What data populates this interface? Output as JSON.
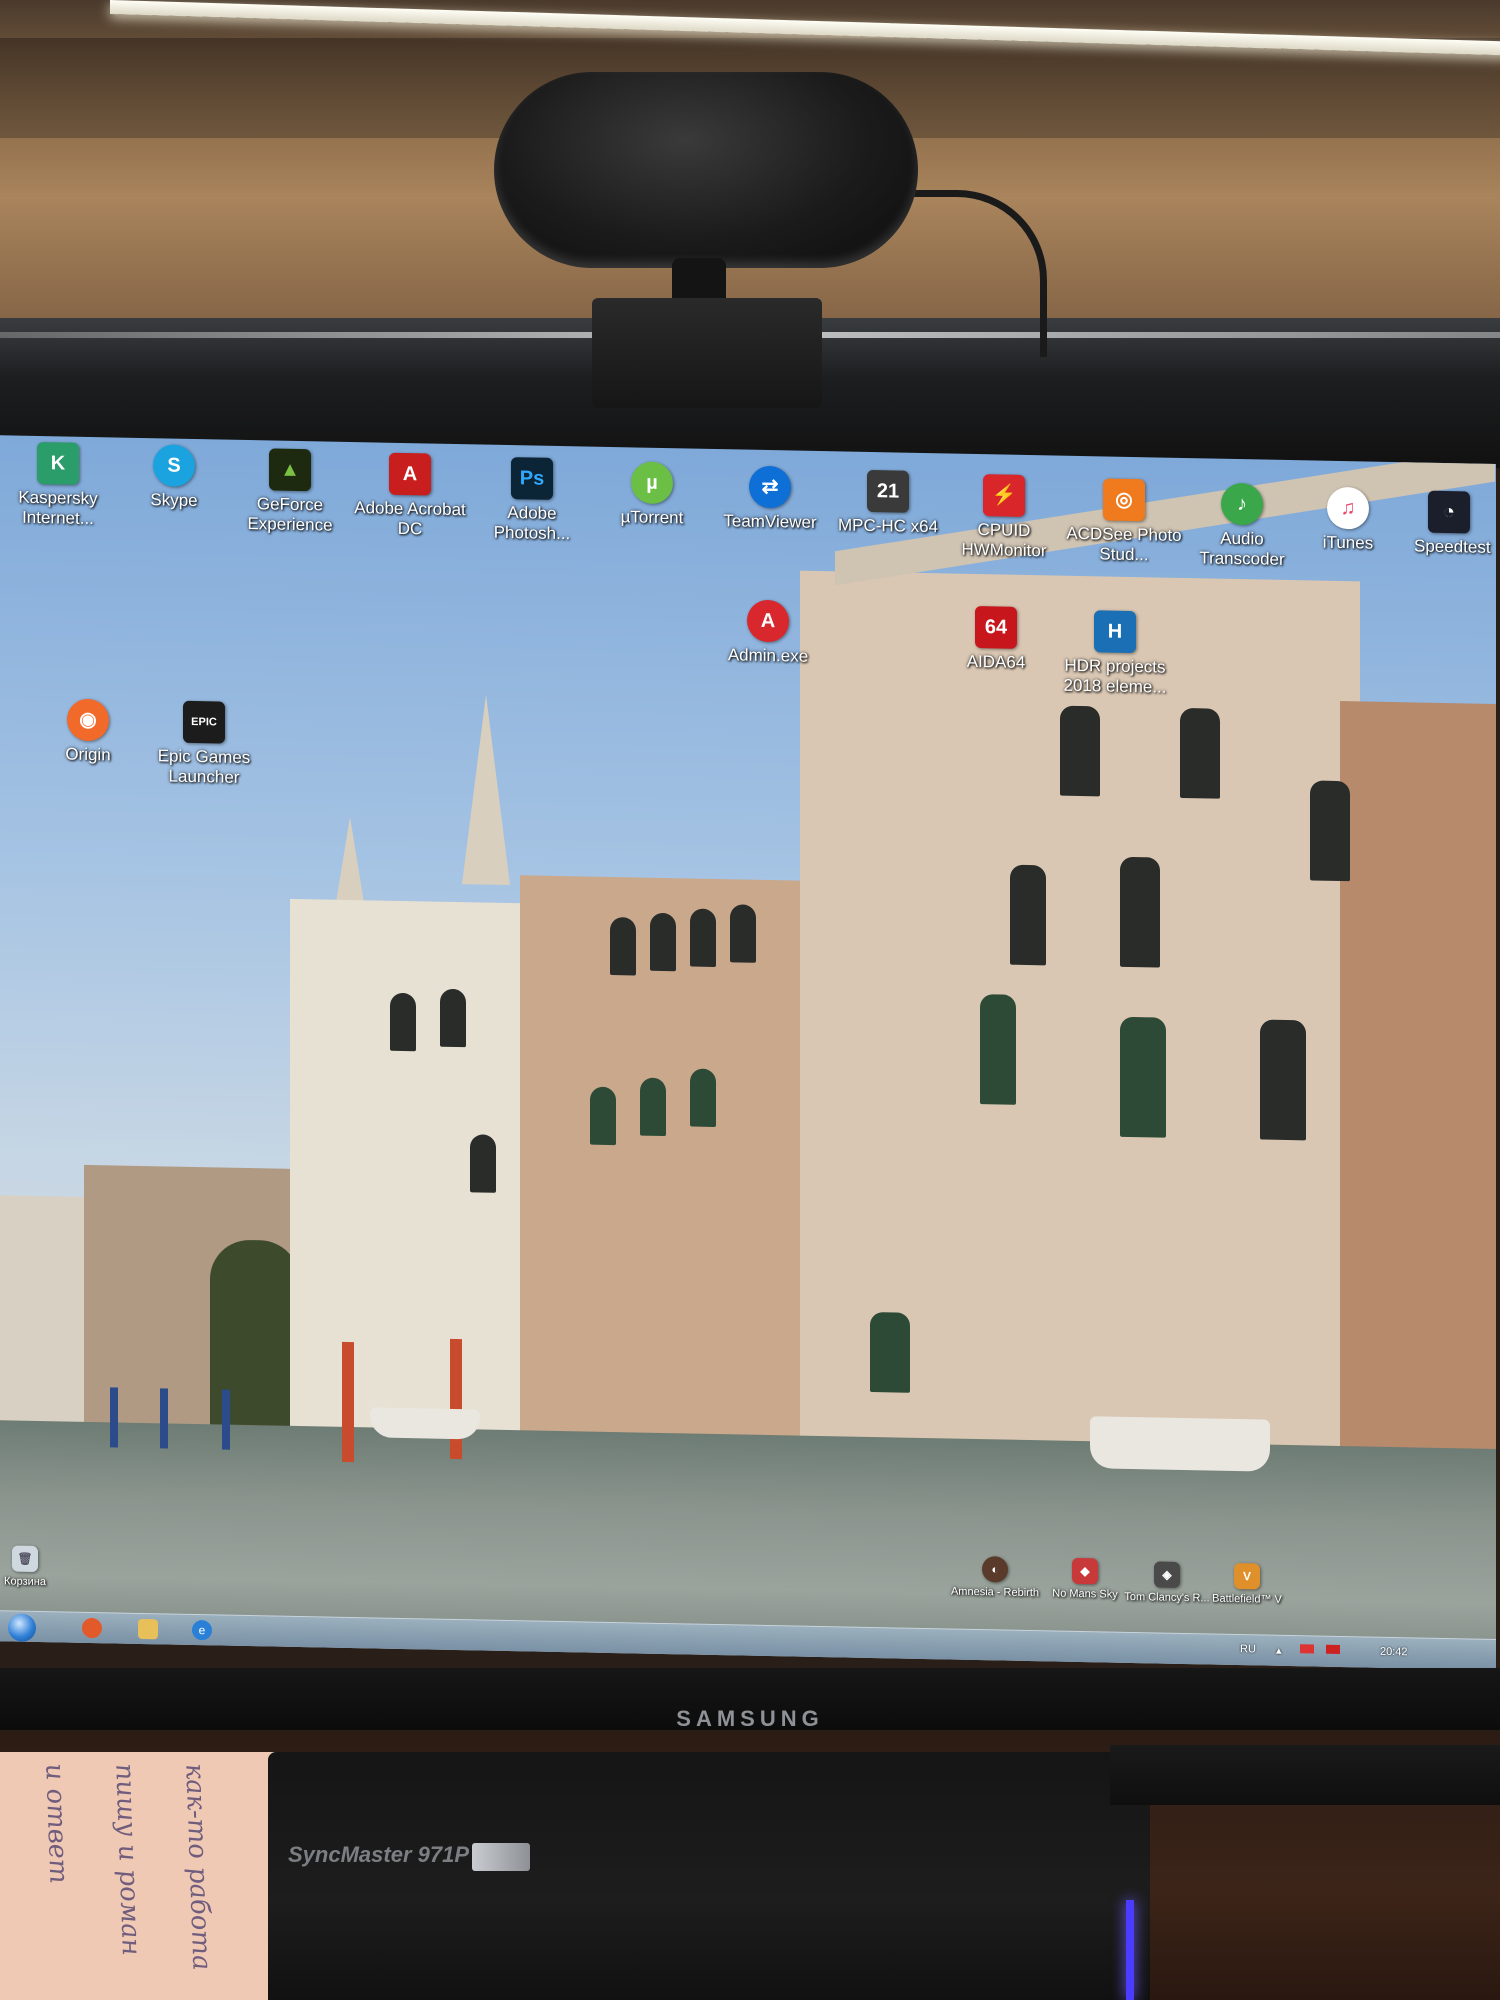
{
  "monitor": {
    "brand": "SAMSUNG",
    "stand_label": "SyncMaster 971P",
    "stand_sub": "",
    "handwriting": [
      "и ответ",
      "пишу и роман",
      "как-то работа"
    ]
  },
  "desktop": {
    "icons_row1": [
      {
        "label": "Kaspersky Internet...",
        "icon": "kaspersky-icon",
        "color": "#2a9d6a",
        "glyph": "K"
      },
      {
        "label": "Skype",
        "icon": "skype-icon",
        "color": "#1ba3e0",
        "glyph": "S"
      },
      {
        "label": "GeForce Experience",
        "icon": "geforce-icon",
        "color": "#1d2a10",
        "glyph": "▲"
      },
      {
        "label": "Adobe Acrobat DC",
        "icon": "acrobat-icon",
        "color": "#c81e1e",
        "glyph": "A"
      },
      {
        "label": "Adobe Photosh...",
        "icon": "photoshop-icon",
        "color": "#0b2436",
        "glyph": "Ps"
      },
      {
        "label": "µTorrent",
        "icon": "utorrent-icon",
        "color": "#6cbf45",
        "glyph": "µ"
      },
      {
        "label": "TeamViewer",
        "icon": "teamviewer-icon",
        "color": "#0e6fd6",
        "glyph": "⇄"
      },
      {
        "label": "MPC-HC x64",
        "icon": "mpc-hc-icon",
        "color": "#3a3a3a",
        "glyph": "21"
      },
      {
        "label": "CPUID HWMonitor",
        "icon": "hwmonitor-icon",
        "color": "#d8262a",
        "glyph": "⚡"
      },
      {
        "label": "ACDSee Photo Stud...",
        "icon": "acdsee-icon",
        "color": "#f07a1e",
        "glyph": "◎"
      },
      {
        "label": "Audio Transcoder",
        "icon": "audio-transcoder-icon",
        "color": "#3aa84a",
        "glyph": "♪"
      },
      {
        "label": "iTunes",
        "icon": "itunes-icon",
        "color": "#e94b6a",
        "glyph": "♫"
      },
      {
        "label": "Speedtest",
        "icon": "speedtest-icon",
        "color": "#1b1f2b",
        "glyph": "◔"
      }
    ],
    "icons_mid": [
      {
        "label": "Admin.exe",
        "icon": "admin-exe-icon",
        "color": "#d8282e",
        "glyph": "A"
      },
      {
        "label": "AIDA64",
        "icon": "aida64-icon",
        "color": "#c8161d",
        "glyph": "64"
      },
      {
        "label": "HDR projects 2018 eleme...",
        "icon": "hdr-projects-icon",
        "color": "#1a6fb5",
        "glyph": "H"
      }
    ],
    "icons_left": [
      {
        "label": "Origin",
        "icon": "origin-icon",
        "color": "#f26a2a",
        "glyph": "◉"
      },
      {
        "label": "Epic Games Launcher",
        "icon": "epic-games-icon",
        "color": "#1c1c1c",
        "glyph": "EPIC"
      }
    ],
    "icons_bottom": [
      {
        "label": "Amnesia - Rebirth",
        "icon": "amnesia-icon",
        "color": "#5a3a2a",
        "glyph": "◐"
      },
      {
        "label": "No Mans Sky",
        "icon": "no-mans-sky-icon",
        "color": "#c83a3a",
        "glyph": "◆"
      },
      {
        "label": "Tom Clancy's R...",
        "icon": "rainbow-six-icon",
        "color": "#4a4a4a",
        "glyph": "◈"
      },
      {
        "label": "Battlefield™ V",
        "icon": "battlefield-icon",
        "color": "#e0902a",
        "glyph": "V"
      }
    ],
    "recycle_bin": {
      "label": "Корзина",
      "icon": "recycle-bin-icon"
    }
  },
  "taskbar": {
    "language": "RU",
    "clock": "20:42",
    "pinned": [
      {
        "icon": "chrome-icon",
        "color": "#e25a2a"
      },
      {
        "icon": "explorer-icon",
        "color": "#e8c05a"
      },
      {
        "icon": "internet-explorer-icon",
        "color": "#2a7fd6"
      }
    ]
  }
}
